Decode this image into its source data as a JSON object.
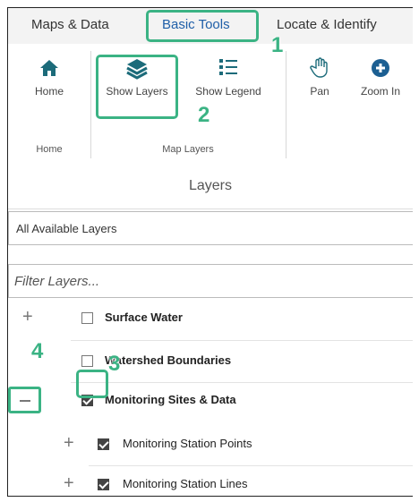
{
  "tabs": [
    {
      "label": "Maps & Data",
      "active": false
    },
    {
      "label": "Basic Tools",
      "active": true
    },
    {
      "label": "Locate & Identify",
      "active": false
    }
  ],
  "ribbon": {
    "home_group": {
      "label": "Home",
      "buttons": [
        {
          "label": "Home",
          "icon": "home-icon"
        }
      ]
    },
    "map_layers_group": {
      "label": "Map Layers",
      "buttons": [
        {
          "label": "Show Layers",
          "icon": "layers-icon"
        },
        {
          "label": "Show Legend",
          "icon": "legend-icon"
        }
      ]
    },
    "nav_buttons": [
      {
        "label": "Pan",
        "icon": "hand-icon"
      },
      {
        "label": "Zoom In",
        "icon": "zoom-in-icon"
      }
    ]
  },
  "layers_panel": {
    "title": "Layers",
    "layer_select": "All Available Layers",
    "filter_placeholder": "Filter Layers...",
    "tree": [
      {
        "label": "Surface Water",
        "checked": false,
        "bold": true,
        "expander": "+",
        "level": 0
      },
      {
        "label": "Watershed Boundaries",
        "checked": false,
        "bold": true,
        "expander": "",
        "level": 0
      },
      {
        "label": "Monitoring Sites & Data",
        "checked": true,
        "bold": true,
        "expander": "-",
        "level": 0
      },
      {
        "label": "Monitoring Station Points",
        "checked": true,
        "bold": false,
        "expander": "+",
        "level": 1
      },
      {
        "label": "Monitoring Station Lines",
        "checked": true,
        "bold": false,
        "expander": "+",
        "level": 1
      }
    ]
  },
  "callouts": [
    "1",
    "2",
    "3",
    "4"
  ],
  "colors": {
    "highlight": "#3bb384",
    "active_tab": "#1f5fa8"
  }
}
